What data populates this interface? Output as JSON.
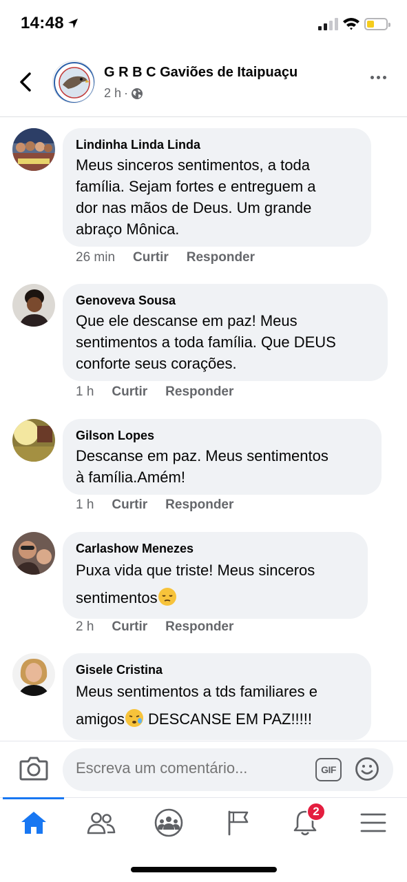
{
  "status_bar": {
    "time": "14:48"
  },
  "header": {
    "group_name": "G R B C Gaviões de Itaipuaçu",
    "time_ago": "2 h",
    "separator": "·"
  },
  "comments": [
    {
      "author": "Lindinha Linda Linda",
      "lines": [
        "Meus sinceros sentimentos, a toda",
        "família.  Sejam fortes e entreguem a",
        "dor nas mãos de Deus. Um grande",
        "abraço Mônica."
      ],
      "time": "26 min",
      "like": "Curtir",
      "reply": "Responder"
    },
    {
      "author": "Genoveva Sousa",
      "lines": [
        "Que ele descanse em paz! Meus",
        "sentimentos a toda família. Que DEUS",
        "conforte seus corações."
      ],
      "time": "1 h",
      "like": "Curtir",
      "reply": "Responder"
    },
    {
      "author": "Gilson Lopes",
      "lines": [
        "Descanse em paz. Meus sentimentos",
        "à família.Amém!"
      ],
      "time": "1 h",
      "like": "Curtir",
      "reply": "Responder"
    },
    {
      "author": "Carlashow Menezes",
      "lines": [
        "Puxa vida que triste! Meus sinceros",
        "sentimentos"
      ],
      "time": "2 h",
      "like": "Curtir",
      "reply": "Responder"
    },
    {
      "author": "Gisele Cristina",
      "lines": [
        "Meus sentimentos a tds familiares e",
        "amigos",
        " DESCANSE EM PAZ!!!!!"
      ],
      "time": "",
      "like": "",
      "reply": ""
    }
  ],
  "composer": {
    "placeholder": "Escreva um comentário...",
    "gif_label": "GIF"
  },
  "tabbar": {
    "notifications_badge": "2"
  },
  "icons": {
    "back": "chevron-left-icon",
    "globe": "globe-icon",
    "more": "more-icon",
    "camera": "camera-icon",
    "smile": "smile-icon",
    "home": "home-icon",
    "friends": "friends-icon",
    "groups": "groups-icon",
    "pages": "flag-icon",
    "notifications": "bell-icon",
    "menu": "menu-icon"
  },
  "colors": {
    "accent": "#1877f2",
    "bubble": "#f0f2f5",
    "secondary_text": "#65676b",
    "badge": "#e41e3f"
  }
}
